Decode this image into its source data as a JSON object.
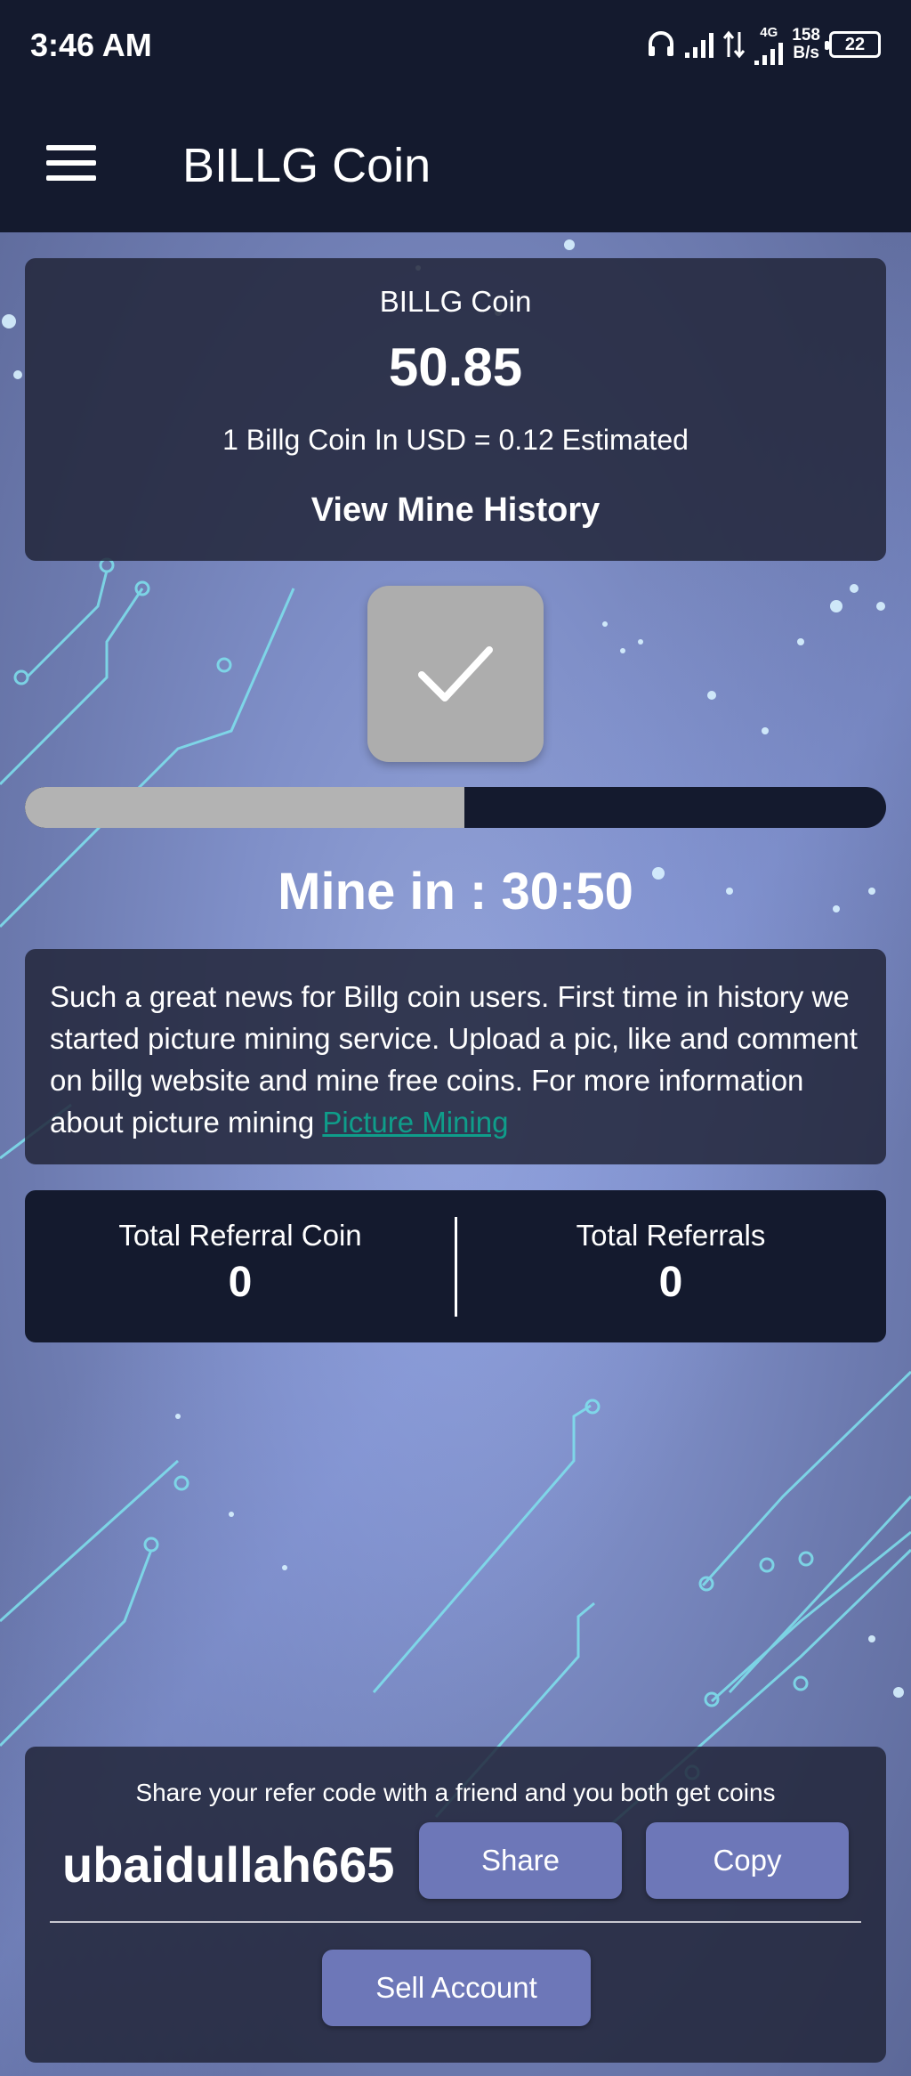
{
  "status_bar": {
    "time": "3:46 AM",
    "network_type": "4G",
    "speed_value": "158",
    "speed_unit": "B/s",
    "battery": "22"
  },
  "app_bar": {
    "menu_icon": "hamburger-menu-icon",
    "title": "BILLG Coin"
  },
  "coin_card": {
    "title": "BILLG Coin",
    "balance": "50.85",
    "rate_text": "1 Billg Coin In USD = 0.12 Estimated",
    "history_link": "View Mine History"
  },
  "mine": {
    "button_icon": "checkmark-icon",
    "progress": 0.51,
    "timer_text": "Mine in : 30:50"
  },
  "news": {
    "text": "Such a great news for Billg coin users. First time in history we started picture mining service. Upload a pic, like and comment on billg website and mine free coins. For more information about picture mining ",
    "link_text": "Picture Mining"
  },
  "referrals": {
    "coin_label": "Total Referral Coin",
    "coin_value": "0",
    "count_label": "Total Referrals",
    "count_value": "0"
  },
  "share": {
    "text": "Share your refer code with a friend and you both get coins",
    "refer_code": "ubaidullah665",
    "share_label": "Share",
    "copy_label": "Copy",
    "sell_label": "Sell Account"
  },
  "colors": {
    "dark_navy": "#141a2e",
    "button_purple": "#6d77b8",
    "link_teal": "#0f9d8a",
    "mine_button_gray": "#adadad"
  }
}
